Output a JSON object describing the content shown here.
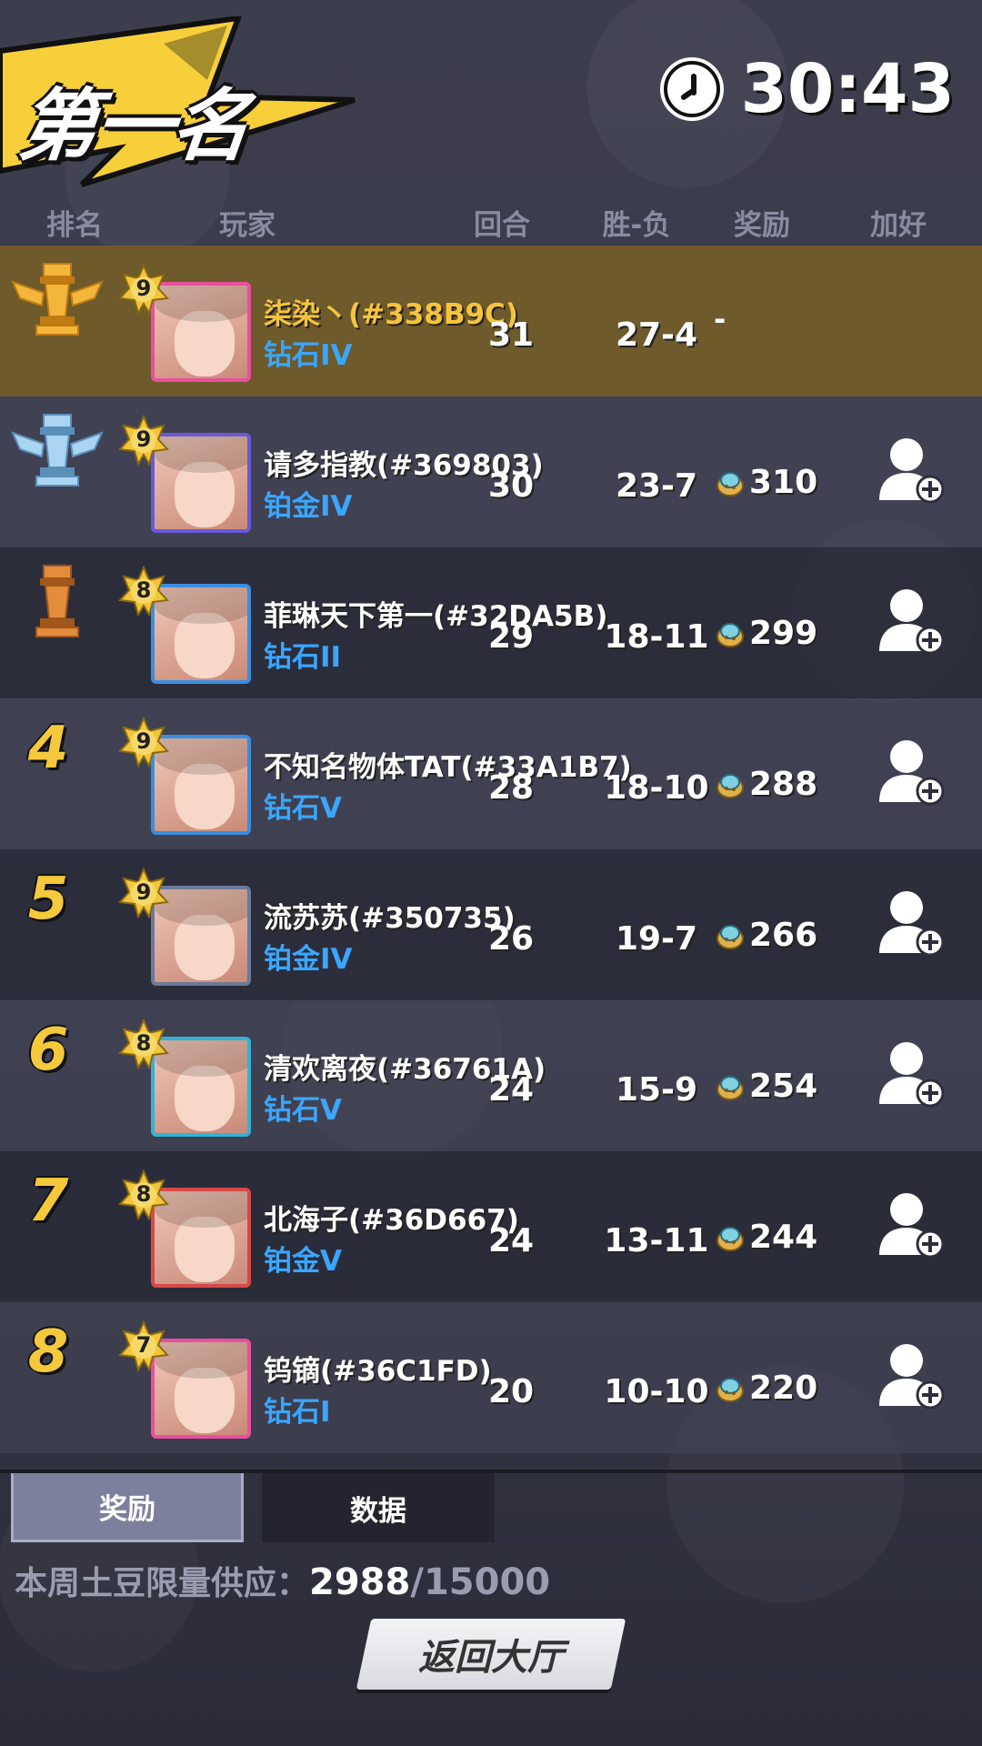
{
  "header": {
    "title": "第一名",
    "timer": "30:43"
  },
  "columns": {
    "rank": "排名",
    "player": "玩家",
    "rounds": "回合",
    "win_loss": "胜-负",
    "reward": "奖励",
    "add_friend": "加好友"
  },
  "rows": [
    {
      "rank": "1",
      "rank_icon": "gold-trophy-icon",
      "level": "9",
      "name": "柒染丶(#338B9C)",
      "tier": "钻石IV",
      "rounds": "31",
      "win_loss": "27-4",
      "reward": "-",
      "self": true
    },
    {
      "rank": "2",
      "rank_icon": "silver-trophy-icon",
      "level": "9",
      "name": "请多指教(#369803)",
      "tier": "铂金IV",
      "rounds": "30",
      "win_loss": "23-7",
      "reward": "310"
    },
    {
      "rank": "3",
      "rank_icon": "bronze-trophy-icon",
      "level": "8",
      "name": "菲琳天下第一(#32DA5B)",
      "tier": "钻石II",
      "rounds": "29",
      "win_loss": "18-11",
      "reward": "299"
    },
    {
      "rank": "4",
      "level": "9",
      "name": "不知名物体TAT(#33A1B7)",
      "tier": "钻石V",
      "rounds": "28",
      "win_loss": "18-10",
      "reward": "288"
    },
    {
      "rank": "5",
      "level": "9",
      "name": "流苏苏(#350735)",
      "tier": "铂金IV",
      "rounds": "26",
      "win_loss": "19-7",
      "reward": "266"
    },
    {
      "rank": "6",
      "level": "8",
      "name": "清欢离夜(#36761A)",
      "tier": "钻石V",
      "rounds": "24",
      "win_loss": "15-9",
      "reward": "254"
    },
    {
      "rank": "7",
      "level": "8",
      "name": "北海子(#36D667)",
      "tier": "铂金V",
      "rounds": "24",
      "win_loss": "13-11",
      "reward": "244"
    },
    {
      "rank": "8",
      "level": "7",
      "name": "钨镝(#36C1FD)",
      "tier": "钻石I",
      "rounds": "20",
      "win_loss": "10-10",
      "reward": "220"
    }
  ],
  "tabs": {
    "reward": "奖励",
    "data": "数据"
  },
  "supply": {
    "label": "本周土豆限量供应：",
    "current": "2988",
    "max": "/15000"
  },
  "back_button": "返回大厅",
  "colors": {
    "self_row": "#6e5a2a",
    "rank_number": "#f5c93c",
    "tier_text": "#3aa6ff",
    "banner_yellow": "#f6cf3a"
  }
}
